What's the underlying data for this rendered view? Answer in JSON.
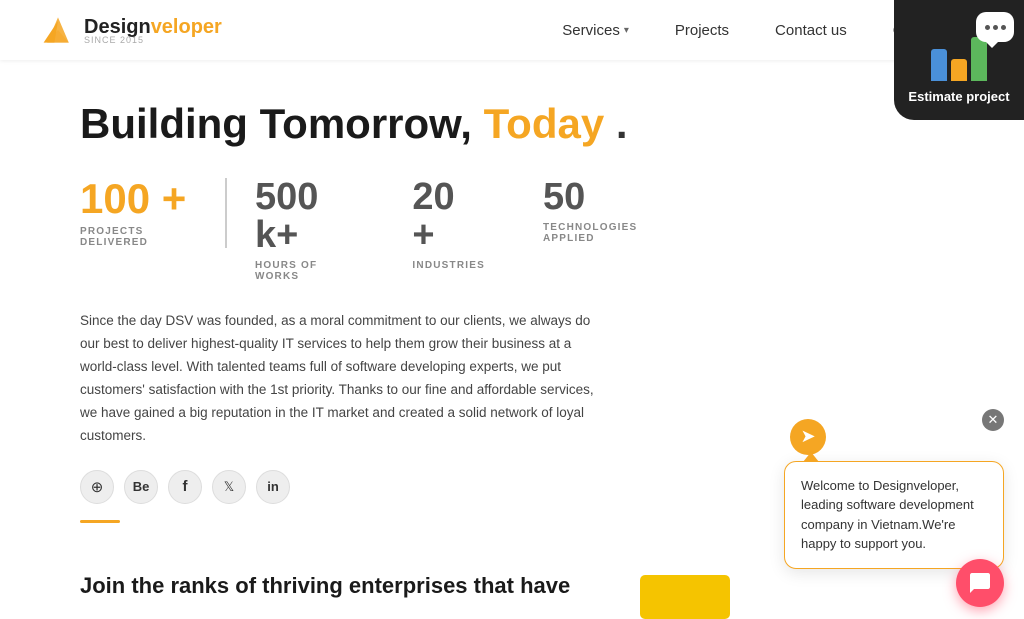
{
  "header": {
    "logo_brand": "Design",
    "logo_accent": "veloper",
    "logo_sub": "SINCE 2015",
    "nav": [
      {
        "id": "services",
        "label": "Services",
        "has_dropdown": true
      },
      {
        "id": "projects",
        "label": "Projects",
        "has_dropdown": false
      },
      {
        "id": "contact",
        "label": "Contact us",
        "has_dropdown": false
      },
      {
        "id": "company",
        "label": "Company",
        "has_dropdown": true
      }
    ]
  },
  "estimate": {
    "label": "Estimate project"
  },
  "hero": {
    "headline_part1": "Building Tomorrow, ",
    "headline_today": "Today",
    "headline_dot": " .",
    "stats": [
      {
        "id": "projects",
        "number": "100 +",
        "label": "PROJECTS DELIVERED",
        "gold": true
      },
      {
        "id": "hours",
        "number": "500 k+",
        "label": "HOURS OF WORKS",
        "gold": false
      },
      {
        "id": "industries",
        "number": "20 +",
        "label": "INDUSTRIES",
        "gold": false
      },
      {
        "id": "technologies",
        "number": "50",
        "label": "TECHNOLOGIES APPLIED",
        "gold": false
      }
    ],
    "description": "Since the day DSV was founded, as a moral commitment to our clients, we always do our best to deliver highest-quality IT services to help them grow their business at a world-class level. With talented teams full of software developing experts, we put customers' satisfaction with the 1st priority. Thanks to our fine and affordable services, we have gained a big reputation in the IT market and created a solid network of loyal customers.",
    "social_icons": [
      {
        "id": "dribbble",
        "symbol": "⊕"
      },
      {
        "id": "behance",
        "symbol": "Be"
      },
      {
        "id": "facebook",
        "symbol": "f"
      },
      {
        "id": "twitter",
        "symbol": "𝕏"
      },
      {
        "id": "linkedin",
        "symbol": "in"
      }
    ]
  },
  "join_section": {
    "text": "Join the ranks of thriving enterprises that have"
  },
  "chat_widget": {
    "message": "Welcome to Designveloper, leading software development company in Vietnam.We're happy to support you."
  }
}
